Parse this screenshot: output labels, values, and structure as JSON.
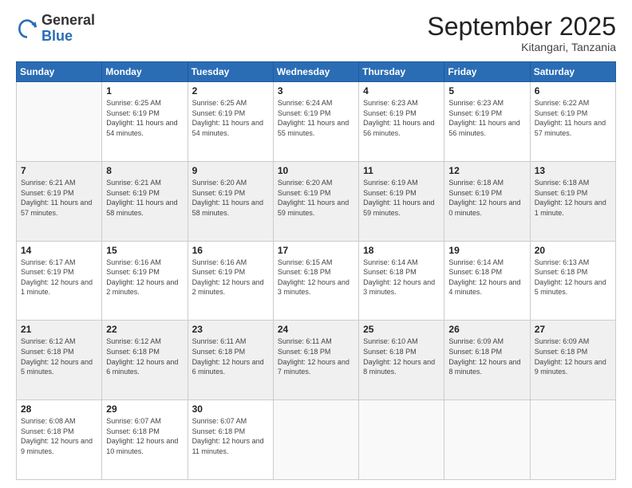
{
  "logo": {
    "general": "General",
    "blue": "Blue"
  },
  "header": {
    "month": "September 2025",
    "location": "Kitangari, Tanzania"
  },
  "weekdays": [
    "Sunday",
    "Monday",
    "Tuesday",
    "Wednesday",
    "Thursday",
    "Friday",
    "Saturday"
  ],
  "weeks": [
    [
      {
        "day": "",
        "sunrise": "",
        "sunset": "",
        "daylight": ""
      },
      {
        "day": "1",
        "sunrise": "Sunrise: 6:25 AM",
        "sunset": "Sunset: 6:19 PM",
        "daylight": "Daylight: 11 hours and 54 minutes."
      },
      {
        "day": "2",
        "sunrise": "Sunrise: 6:25 AM",
        "sunset": "Sunset: 6:19 PM",
        "daylight": "Daylight: 11 hours and 54 minutes."
      },
      {
        "day": "3",
        "sunrise": "Sunrise: 6:24 AM",
        "sunset": "Sunset: 6:19 PM",
        "daylight": "Daylight: 11 hours and 55 minutes."
      },
      {
        "day": "4",
        "sunrise": "Sunrise: 6:23 AM",
        "sunset": "Sunset: 6:19 PM",
        "daylight": "Daylight: 11 hours and 56 minutes."
      },
      {
        "day": "5",
        "sunrise": "Sunrise: 6:23 AM",
        "sunset": "Sunset: 6:19 PM",
        "daylight": "Daylight: 11 hours and 56 minutes."
      },
      {
        "day": "6",
        "sunrise": "Sunrise: 6:22 AM",
        "sunset": "Sunset: 6:19 PM",
        "daylight": "Daylight: 11 hours and 57 minutes."
      }
    ],
    [
      {
        "day": "7",
        "sunrise": "Sunrise: 6:21 AM",
        "sunset": "Sunset: 6:19 PM",
        "daylight": "Daylight: 11 hours and 57 minutes."
      },
      {
        "day": "8",
        "sunrise": "Sunrise: 6:21 AM",
        "sunset": "Sunset: 6:19 PM",
        "daylight": "Daylight: 11 hours and 58 minutes."
      },
      {
        "day": "9",
        "sunrise": "Sunrise: 6:20 AM",
        "sunset": "Sunset: 6:19 PM",
        "daylight": "Daylight: 11 hours and 58 minutes."
      },
      {
        "day": "10",
        "sunrise": "Sunrise: 6:20 AM",
        "sunset": "Sunset: 6:19 PM",
        "daylight": "Daylight: 11 hours and 59 minutes."
      },
      {
        "day": "11",
        "sunrise": "Sunrise: 6:19 AM",
        "sunset": "Sunset: 6:19 PM",
        "daylight": "Daylight: 11 hours and 59 minutes."
      },
      {
        "day": "12",
        "sunrise": "Sunrise: 6:18 AM",
        "sunset": "Sunset: 6:19 PM",
        "daylight": "Daylight: 12 hours and 0 minutes."
      },
      {
        "day": "13",
        "sunrise": "Sunrise: 6:18 AM",
        "sunset": "Sunset: 6:19 PM",
        "daylight": "Daylight: 12 hours and 1 minute."
      }
    ],
    [
      {
        "day": "14",
        "sunrise": "Sunrise: 6:17 AM",
        "sunset": "Sunset: 6:19 PM",
        "daylight": "Daylight: 12 hours and 1 minute."
      },
      {
        "day": "15",
        "sunrise": "Sunrise: 6:16 AM",
        "sunset": "Sunset: 6:19 PM",
        "daylight": "Daylight: 12 hours and 2 minutes."
      },
      {
        "day": "16",
        "sunrise": "Sunrise: 6:16 AM",
        "sunset": "Sunset: 6:19 PM",
        "daylight": "Daylight: 12 hours and 2 minutes."
      },
      {
        "day": "17",
        "sunrise": "Sunrise: 6:15 AM",
        "sunset": "Sunset: 6:18 PM",
        "daylight": "Daylight: 12 hours and 3 minutes."
      },
      {
        "day": "18",
        "sunrise": "Sunrise: 6:14 AM",
        "sunset": "Sunset: 6:18 PM",
        "daylight": "Daylight: 12 hours and 3 minutes."
      },
      {
        "day": "19",
        "sunrise": "Sunrise: 6:14 AM",
        "sunset": "Sunset: 6:18 PM",
        "daylight": "Daylight: 12 hours and 4 minutes."
      },
      {
        "day": "20",
        "sunrise": "Sunrise: 6:13 AM",
        "sunset": "Sunset: 6:18 PM",
        "daylight": "Daylight: 12 hours and 5 minutes."
      }
    ],
    [
      {
        "day": "21",
        "sunrise": "Sunrise: 6:12 AM",
        "sunset": "Sunset: 6:18 PM",
        "daylight": "Daylight: 12 hours and 5 minutes."
      },
      {
        "day": "22",
        "sunrise": "Sunrise: 6:12 AM",
        "sunset": "Sunset: 6:18 PM",
        "daylight": "Daylight: 12 hours and 6 minutes."
      },
      {
        "day": "23",
        "sunrise": "Sunrise: 6:11 AM",
        "sunset": "Sunset: 6:18 PM",
        "daylight": "Daylight: 12 hours and 6 minutes."
      },
      {
        "day": "24",
        "sunrise": "Sunrise: 6:11 AM",
        "sunset": "Sunset: 6:18 PM",
        "daylight": "Daylight: 12 hours and 7 minutes."
      },
      {
        "day": "25",
        "sunrise": "Sunrise: 6:10 AM",
        "sunset": "Sunset: 6:18 PM",
        "daylight": "Daylight: 12 hours and 8 minutes."
      },
      {
        "day": "26",
        "sunrise": "Sunrise: 6:09 AM",
        "sunset": "Sunset: 6:18 PM",
        "daylight": "Daylight: 12 hours and 8 minutes."
      },
      {
        "day": "27",
        "sunrise": "Sunrise: 6:09 AM",
        "sunset": "Sunset: 6:18 PM",
        "daylight": "Daylight: 12 hours and 9 minutes."
      }
    ],
    [
      {
        "day": "28",
        "sunrise": "Sunrise: 6:08 AM",
        "sunset": "Sunset: 6:18 PM",
        "daylight": "Daylight: 12 hours and 9 minutes."
      },
      {
        "day": "29",
        "sunrise": "Sunrise: 6:07 AM",
        "sunset": "Sunset: 6:18 PM",
        "daylight": "Daylight: 12 hours and 10 minutes."
      },
      {
        "day": "30",
        "sunrise": "Sunrise: 6:07 AM",
        "sunset": "Sunset: 6:18 PM",
        "daylight": "Daylight: 12 hours and 11 minutes."
      },
      {
        "day": "",
        "sunrise": "",
        "sunset": "",
        "daylight": ""
      },
      {
        "day": "",
        "sunrise": "",
        "sunset": "",
        "daylight": ""
      },
      {
        "day": "",
        "sunrise": "",
        "sunset": "",
        "daylight": ""
      },
      {
        "day": "",
        "sunrise": "",
        "sunset": "",
        "daylight": ""
      }
    ]
  ]
}
